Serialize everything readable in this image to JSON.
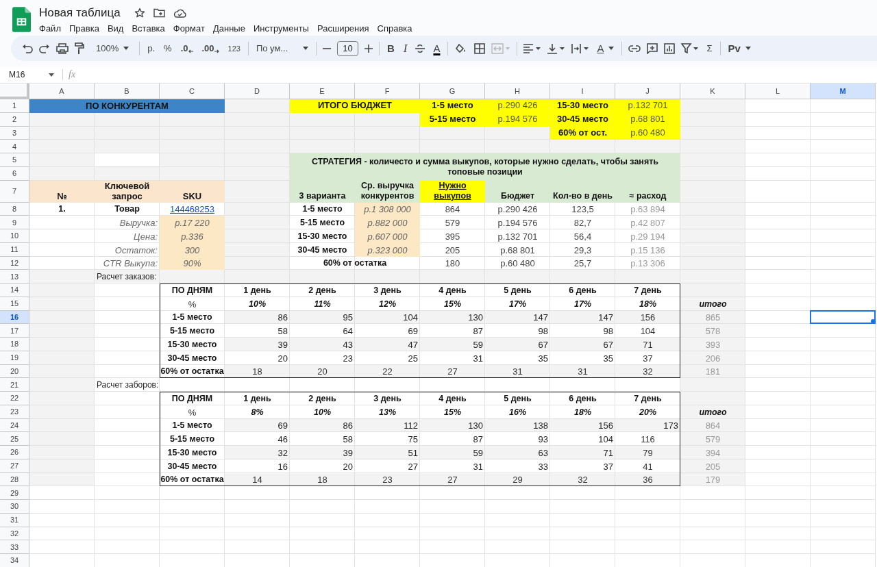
{
  "document": {
    "title": "Новая таблица"
  },
  "menu": [
    "Файл",
    "Правка",
    "Вид",
    "Вставка",
    "Формат",
    "Данные",
    "Инструменты",
    "Расширения",
    "Справка"
  ],
  "toolbar": {
    "zoom": "100%",
    "currency": "р.",
    "percent": "%",
    "decimals_decrease": ".0",
    "decimals_increase": ".00",
    "format": "123",
    "font": "По ум...",
    "font_size": "10",
    "bold": "B",
    "italic": "I",
    "text_color": "A",
    "text_rotation": "A",
    "merge_disabled": true,
    "functions": "Σ",
    "input_tools": "Рv"
  },
  "formula_bar": {
    "name_box": "M16",
    "fx": "fx"
  },
  "sheet": {
    "columns": [
      {
        "label": "A",
        "selected": false
      },
      {
        "label": "B",
        "selected": false
      },
      {
        "label": "C",
        "selected": false
      },
      {
        "label": "D",
        "selected": false
      },
      {
        "label": "E",
        "selected": false
      },
      {
        "label": "F",
        "selected": false
      },
      {
        "label": "G",
        "selected": false
      },
      {
        "label": "H",
        "selected": false
      },
      {
        "label": "I",
        "selected": false
      },
      {
        "label": "J",
        "selected": false
      },
      {
        "label": "K",
        "selected": false
      },
      {
        "label": "L",
        "selected": false
      },
      {
        "label": "M",
        "selected": true
      }
    ],
    "rows": [
      {
        "label": "1",
        "selected": false,
        "cells": [
          {
            "text": "ПО КОНКУРЕНТАМ",
            "kind": "banner"
          },
          {
            "text": "ИТОГО БЮДЖЕТ",
            "kind": "flag"
          },
          {
            "text": "1-5 место",
            "kind": "flag"
          },
          {
            "text": "р.290 426",
            "kind": "flagvalue"
          },
          {
            "text": "15-30 место",
            "kind": "flag"
          },
          {
            "text": "р.132 701",
            "kind": "flagvalue"
          }
        ]
      },
      {
        "label": "2",
        "selected": false,
        "cells": [
          {
            "text": "5-15 место",
            "kind": "flag"
          },
          {
            "text": "р.194 576",
            "kind": "flagvalue"
          },
          {
            "text": "30-45 место",
            "kind": "flag"
          },
          {
            "text": "р.68 801",
            "kind": "flagvalue"
          }
        ]
      },
      {
        "label": "3",
        "selected": false,
        "cells": [
          {
            "text": "60% от ост.",
            "kind": "flag"
          },
          {
            "text": "р.60 480",
            "kind": "flagvalue"
          }
        ]
      },
      {
        "label": "4",
        "selected": false
      },
      {
        "label": "5",
        "selected": false,
        "cells": [
          {
            "text": "СТРАТЕГИЯ - количесто и сумма выкупов, которые нужно сделать, чтобы занять топовые позиции",
            "kind": "greentitle"
          }
        ]
      },
      {
        "label": "6",
        "selected": false
      },
      {
        "label": "7",
        "selected": false,
        "cells": [
          {
            "text": "№",
            "kind": "peachhead"
          },
          {
            "text": "Ключевой запрос",
            "kind": "peachhead"
          },
          {
            "text": "SKU",
            "kind": "peachhead"
          },
          {
            "text": "3 варианта",
            "kind": "greenhead"
          },
          {
            "text": "Ср. выручка конкурентов",
            "kind": "greenhead"
          },
          {
            "text": "Нужно выкупов",
            "kind": "flaghead"
          },
          {
            "text": "Бюджет",
            "kind": "greenhead"
          },
          {
            "text": "Кол-во в день",
            "kind": "greenhead"
          },
          {
            "text": "≈ расход",
            "kind": "greenhead"
          }
        ]
      },
      {
        "label": "8",
        "selected": false,
        "cells": [
          {
            "text": "1.",
            "kind": "bold"
          },
          {
            "text": "Товар",
            "kind": "bold"
          },
          {
            "text": "144468253",
            "kind": "link"
          },
          {
            "text": "1-5 место",
            "kind": "bold"
          },
          {
            "text": "р.1 308 000",
            "kind": "input"
          },
          {
            "text": "864",
            "kind": "value"
          },
          {
            "text": "р.290 426",
            "kind": "value"
          },
          {
            "text": "123,5",
            "kind": "value"
          },
          {
            "text": "р.63 894",
            "kind": "muted"
          }
        ]
      },
      {
        "label": "9",
        "selected": false,
        "cells": [
          {
            "text": "Выручка:",
            "kind": "fieldlabel"
          },
          {
            "text": "р.17 220",
            "kind": "input"
          },
          {
            "text": "5-15 место",
            "kind": "bold"
          },
          {
            "text": "р.882 000",
            "kind": "input"
          },
          {
            "text": "579",
            "kind": "value"
          },
          {
            "text": "р.194 576",
            "kind": "value"
          },
          {
            "text": "82,7",
            "kind": "value"
          },
          {
            "text": "р.42 807",
            "kind": "muted"
          }
        ]
      },
      {
        "label": "10",
        "selected": false,
        "cells": [
          {
            "text": "Цена:",
            "kind": "fieldlabel"
          },
          {
            "text": "р.336",
            "kind": "input"
          },
          {
            "text": "15-30 место",
            "kind": "bold"
          },
          {
            "text": "р.607 000",
            "kind": "input"
          },
          {
            "text": "395",
            "kind": "value"
          },
          {
            "text": "р.132 701",
            "kind": "value"
          },
          {
            "text": "56,4",
            "kind": "value"
          },
          {
            "text": "р.29 194",
            "kind": "muted"
          }
        ]
      },
      {
        "label": "11",
        "selected": false,
        "cells": [
          {
            "text": "Остаток:",
            "kind": "fieldlabel"
          },
          {
            "text": "300",
            "kind": "input"
          },
          {
            "text": "30-45 место",
            "kind": "bold"
          },
          {
            "text": "р.323 000",
            "kind": "input"
          },
          {
            "text": "205",
            "kind": "value"
          },
          {
            "text": "р.68 801",
            "kind": "value"
          },
          {
            "text": "29,3",
            "kind": "value"
          },
          {
            "text": "р.15 136",
            "kind": "muted"
          }
        ]
      },
      {
        "label": "12",
        "selected": false,
        "cells": [
          {
            "text": "CTR Выкупа:",
            "kind": "fieldlabel"
          },
          {
            "text": "90%",
            "kind": "input"
          },
          {
            "text": "60% от остатка",
            "kind": "bold"
          },
          {
            "text": "180",
            "kind": "value"
          },
          {
            "text": "р.60 480",
            "kind": "value"
          },
          {
            "text": "25,7",
            "kind": "value"
          },
          {
            "text": "р.13 306",
            "kind": "muted"
          }
        ]
      },
      {
        "label": "13",
        "selected": false,
        "cells": [
          {
            "text": "Расчет заказов:",
            "kind": "note"
          }
        ]
      },
      {
        "label": "14",
        "selected": false,
        "cells": [
          {
            "text": "ПО ДНЯМ",
            "kind": "bold"
          },
          {
            "text": "1 день",
            "kind": "bold"
          },
          {
            "text": "2 день",
            "kind": "bold"
          },
          {
            "text": "3 день",
            "kind": "bold"
          },
          {
            "text": "4 день",
            "kind": "bold"
          },
          {
            "text": "5 день",
            "kind": "bold"
          },
          {
            "text": "6 день",
            "kind": "bold"
          },
          {
            "text": "7 день",
            "kind": "bold"
          }
        ]
      },
      {
        "label": "15",
        "selected": false,
        "cells": [
          {
            "text": "%",
            "kind": "centered"
          },
          {
            "text": "10%",
            "kind": "percent"
          },
          {
            "text": "11%",
            "kind": "percent"
          },
          {
            "text": "12%",
            "kind": "percent"
          },
          {
            "text": "15%",
            "kind": "percent"
          },
          {
            "text": "17%",
            "kind": "percent"
          },
          {
            "text": "17%",
            "kind": "percent"
          },
          {
            "text": "18%",
            "kind": "percent"
          },
          {
            "text": "итого",
            "kind": "total"
          }
        ]
      },
      {
        "label": "16",
        "selected": true,
        "cells": [
          {
            "text": "1-5 место",
            "kind": "bold"
          },
          {
            "text": "86",
            "kind": "number"
          },
          {
            "text": "95",
            "kind": "number"
          },
          {
            "text": "104",
            "kind": "number"
          },
          {
            "text": "130",
            "kind": "number"
          },
          {
            "text": "147",
            "kind": "number"
          },
          {
            "text": "147",
            "kind": "number"
          },
          {
            "text": "156",
            "kind": "centered"
          },
          {
            "text": "865",
            "kind": "muted"
          }
        ]
      },
      {
        "label": "17",
        "selected": false,
        "cells": [
          {
            "text": "5-15 место",
            "kind": "bold"
          },
          {
            "text": "58",
            "kind": "number"
          },
          {
            "text": "64",
            "kind": "number"
          },
          {
            "text": "69",
            "kind": "number"
          },
          {
            "text": "87",
            "kind": "number"
          },
          {
            "text": "98",
            "kind": "number"
          },
          {
            "text": "98",
            "kind": "number"
          },
          {
            "text": "104",
            "kind": "centered"
          },
          {
            "text": "578",
            "kind": "muted"
          }
        ]
      },
      {
        "label": "18",
        "selected": false,
        "cells": [
          {
            "text": "15-30 место",
            "kind": "bold"
          },
          {
            "text": "39",
            "kind": "number"
          },
          {
            "text": "43",
            "kind": "number"
          },
          {
            "text": "47",
            "kind": "number"
          },
          {
            "text": "59",
            "kind": "number"
          },
          {
            "text": "67",
            "kind": "number"
          },
          {
            "text": "67",
            "kind": "number"
          },
          {
            "text": "71",
            "kind": "centered"
          },
          {
            "text": "393",
            "kind": "muted"
          }
        ]
      },
      {
        "label": "19",
        "selected": false,
        "cells": [
          {
            "text": "30-45 место",
            "kind": "bold"
          },
          {
            "text": "20",
            "kind": "number"
          },
          {
            "text": "23",
            "kind": "number"
          },
          {
            "text": "25",
            "kind": "number"
          },
          {
            "text": "31",
            "kind": "number"
          },
          {
            "text": "35",
            "kind": "number"
          },
          {
            "text": "35",
            "kind": "number"
          },
          {
            "text": "37",
            "kind": "centered"
          },
          {
            "text": "206",
            "kind": "muted"
          }
        ]
      },
      {
        "label": "20",
        "selected": false,
        "cells": [
          {
            "text": "60% от остатка",
            "kind": "bold"
          },
          {
            "text": "18",
            "kind": "centered"
          },
          {
            "text": "20",
            "kind": "centered"
          },
          {
            "text": "22",
            "kind": "centered"
          },
          {
            "text": "27",
            "kind": "centered"
          },
          {
            "text": "31",
            "kind": "centered"
          },
          {
            "text": "31",
            "kind": "centered"
          },
          {
            "text": "32",
            "kind": "centered"
          },
          {
            "text": "181",
            "kind": "muted"
          }
        ]
      },
      {
        "label": "21",
        "selected": false,
        "cells": [
          {
            "text": "Расчет заборов:",
            "kind": "note"
          }
        ]
      },
      {
        "label": "22",
        "selected": false,
        "cells": [
          {
            "text": "ПО ДНЯМ",
            "kind": "bold"
          },
          {
            "text": "1 день",
            "kind": "bold"
          },
          {
            "text": "2 день",
            "kind": "bold"
          },
          {
            "text": "3 день",
            "kind": "bold"
          },
          {
            "text": "4 день",
            "kind": "bold"
          },
          {
            "text": "5 день",
            "kind": "bold"
          },
          {
            "text": "6 день",
            "kind": "bold"
          },
          {
            "text": "7 день",
            "kind": "bold"
          }
        ]
      },
      {
        "label": "23",
        "selected": false,
        "cells": [
          {
            "text": "%",
            "kind": "centered"
          },
          {
            "text": "8%",
            "kind": "percent"
          },
          {
            "text": "10%",
            "kind": "percent"
          },
          {
            "text": "13%",
            "kind": "percent"
          },
          {
            "text": "15%",
            "kind": "percent"
          },
          {
            "text": "16%",
            "kind": "percent"
          },
          {
            "text": "18%",
            "kind": "percent"
          },
          {
            "text": "20%",
            "kind": "percent"
          },
          {
            "text": "итого",
            "kind": "total"
          }
        ]
      },
      {
        "label": "24",
        "selected": false,
        "cells": [
          {
            "text": "1-5 место",
            "kind": "bold"
          },
          {
            "text": "69",
            "kind": "number"
          },
          {
            "text": "86",
            "kind": "number"
          },
          {
            "text": "112",
            "kind": "number"
          },
          {
            "text": "130",
            "kind": "number"
          },
          {
            "text": "138",
            "kind": "number"
          },
          {
            "text": "156",
            "kind": "number"
          },
          {
            "text": "173",
            "kind": "number"
          },
          {
            "text": "864",
            "kind": "muted"
          }
        ]
      },
      {
        "label": "25",
        "selected": false,
        "cells": [
          {
            "text": "5-15 место",
            "kind": "bold"
          },
          {
            "text": "46",
            "kind": "number"
          },
          {
            "text": "58",
            "kind": "number"
          },
          {
            "text": "75",
            "kind": "number"
          },
          {
            "text": "87",
            "kind": "number"
          },
          {
            "text": "93",
            "kind": "number"
          },
          {
            "text": "104",
            "kind": "number"
          },
          {
            "text": "116",
            "kind": "centered"
          },
          {
            "text": "579",
            "kind": "muted"
          }
        ]
      },
      {
        "label": "26",
        "selected": false,
        "cells": [
          {
            "text": "15-30 место",
            "kind": "bold"
          },
          {
            "text": "32",
            "kind": "number"
          },
          {
            "text": "39",
            "kind": "number"
          },
          {
            "text": "51",
            "kind": "number"
          },
          {
            "text": "59",
            "kind": "number"
          },
          {
            "text": "63",
            "kind": "number"
          },
          {
            "text": "71",
            "kind": "number"
          },
          {
            "text": "79",
            "kind": "centered"
          },
          {
            "text": "394",
            "kind": "muted"
          }
        ]
      },
      {
        "label": "27",
        "selected": false,
        "cells": [
          {
            "text": "30-45 место",
            "kind": "bold"
          },
          {
            "text": "16",
            "kind": "number"
          },
          {
            "text": "20",
            "kind": "number"
          },
          {
            "text": "27",
            "kind": "number"
          },
          {
            "text": "31",
            "kind": "number"
          },
          {
            "text": "33",
            "kind": "number"
          },
          {
            "text": "37",
            "kind": "number"
          },
          {
            "text": "41",
            "kind": "centered"
          },
          {
            "text": "205",
            "kind": "muted"
          }
        ]
      },
      {
        "label": "28",
        "selected": false,
        "cells": [
          {
            "text": "60% от остатка",
            "kind": "bold"
          },
          {
            "text": "14",
            "kind": "centered"
          },
          {
            "text": "18",
            "kind": "centered"
          },
          {
            "text": "23",
            "kind": "centered"
          },
          {
            "text": "27",
            "kind": "centered"
          },
          {
            "text": "29",
            "kind": "centered"
          },
          {
            "text": "32",
            "kind": "centered"
          },
          {
            "text": "36",
            "kind": "centered"
          },
          {
            "text": "179",
            "kind": "muted"
          }
        ]
      },
      {
        "label": "29",
        "selected": false
      },
      {
        "label": "30",
        "selected": false
      },
      {
        "label": "31",
        "selected": false
      },
      {
        "label": "32",
        "selected": false
      },
      {
        "label": "33",
        "selected": false
      },
      {
        "label": "34",
        "selected": false
      }
    ]
  }
}
